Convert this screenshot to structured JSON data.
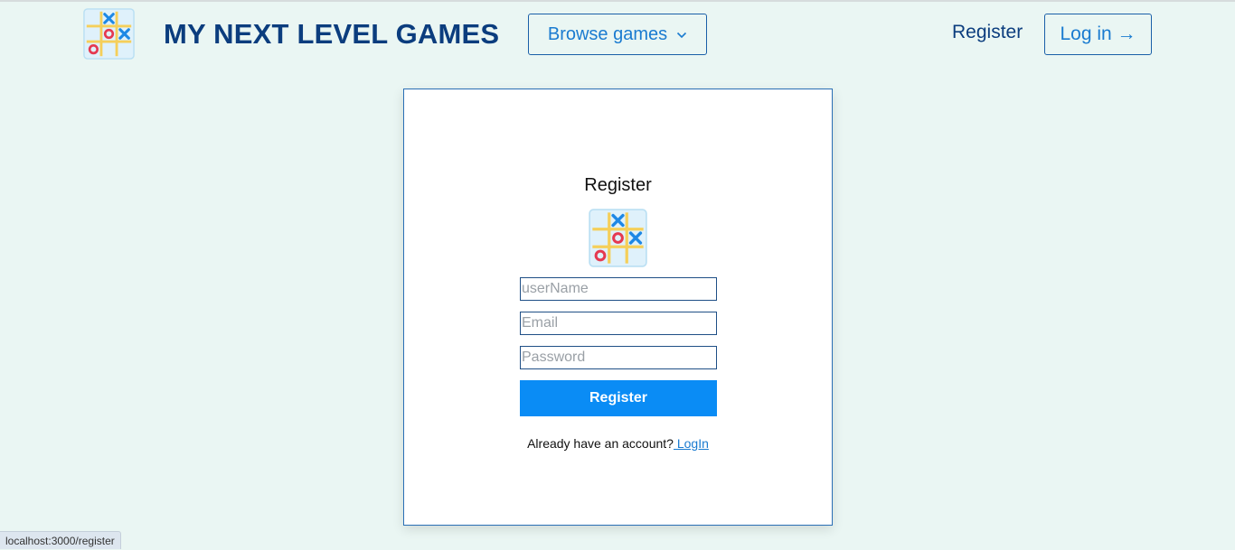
{
  "header": {
    "brand": "MY NEXT LEVEL GAMES",
    "browse_label": "Browse games",
    "register_link": "Register",
    "login_label": "Log in →"
  },
  "form": {
    "title": "Register",
    "username_placeholder": "userName",
    "email_placeholder": "Email",
    "password_placeholder": "Password",
    "submit_label": "Register",
    "footer_text": "Already have an account?",
    "login_link": " LogIn"
  },
  "status": {
    "url": "localhost:3000/register"
  },
  "icons": {
    "logo": "tic-tac-toe-icon",
    "chevron": "chevron-down-icon"
  },
  "colors": {
    "brand": "#0b3d7e",
    "accent": "#0a8cf5",
    "background": "#eaf6f3"
  }
}
